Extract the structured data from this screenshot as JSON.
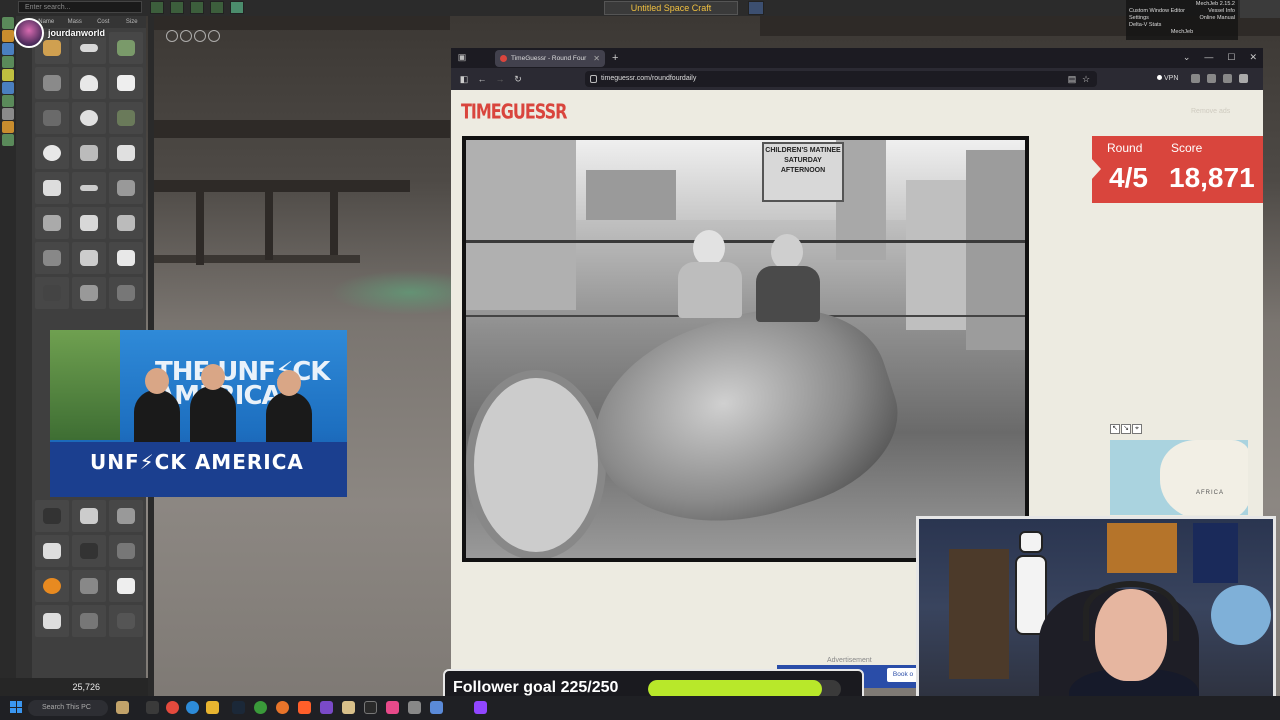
{
  "ksp": {
    "search_placeholder": "Enter search...",
    "vessel_name": "Untitled Space Craft",
    "parts_columns": [
      "Name",
      "Mass",
      "Cost",
      "Size"
    ],
    "funds": "25,726",
    "mechjeb": {
      "version": "MechJeb 2.15.2",
      "items": [
        "Custom Window Editor",
        "Settings",
        "Delta-V Stats"
      ],
      "items_right": [
        "Vessel Info",
        "Online Manual"
      ],
      "footer": "MechJeb"
    }
  },
  "streamer": {
    "name": "jourdanworld"
  },
  "video_overlay": {
    "banner": "THE UNF⚡CK AMERICA",
    "shirt_text": "UNF⚡CK AMERICA"
  },
  "browser": {
    "tab_title": "TimeGuessr - Round Four",
    "url": "timeguessr.com/roundfourdaily",
    "vpn_label": "VPN"
  },
  "timeguessr": {
    "logo": "TIMEGUESSR",
    "remove_ads": "Remove ads",
    "round_label": "Round",
    "score_label": "Score",
    "round_value": "4/5",
    "score_value": "18,871",
    "photo_sign": "CHILDREN'S MATINEE SATURDAY AFTERNOON",
    "map_label": "AFRICA",
    "ad_label": "Advertisement",
    "ad_button": "Book o"
  },
  "follower_goal": {
    "text": "Follower goal 225/250",
    "current": 225,
    "target": 250,
    "fill_color": "#b8e82a"
  },
  "taskbar": {
    "search_placeholder": "Search This PC"
  },
  "colors": {
    "accent_red": "#d9453d",
    "ksp_gold": "#f0c040"
  }
}
